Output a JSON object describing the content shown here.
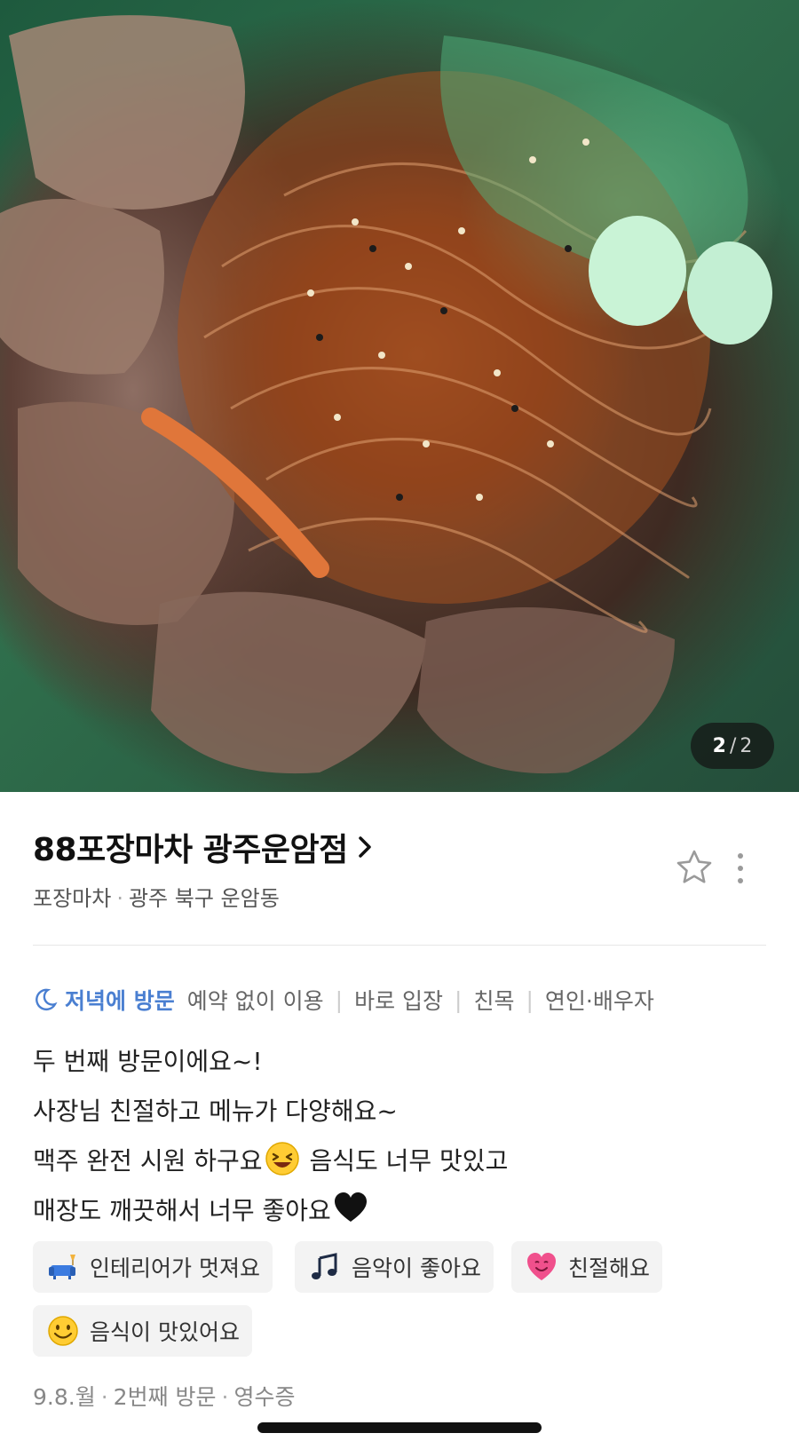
{
  "photo": {
    "counter_current": "2",
    "counter_separator": "/",
    "counter_total": "2"
  },
  "place": {
    "name": "88포장마차 광주운암점",
    "category": "포장마차",
    "separator": "·",
    "location": "광주 북구 운암동",
    "star_icon": "star-outline-icon",
    "more_icon": "vertical-ellipsis-icon"
  },
  "visit": {
    "icon": "moon-icon",
    "time": "저녁에 방문",
    "tags": [
      "예약 없이 이용",
      "바로 입장",
      "친목",
      "연인·배우자"
    ],
    "bar": "|"
  },
  "review": {
    "line1": "두 번째 방문이에요~!",
    "line2": "사장님 친절하고 메뉴가 다양해요~",
    "line3a": "맥주 완전 시원 하구요",
    "line3b": " 음식도 너무 맛있고",
    "line4": "매장도 깨끗해서 너무 좋아요",
    "emoji_laugh": "laughing-face-emoji",
    "emoji_heart": "black-heart-emoji"
  },
  "keywords": [
    {
      "label": "인테리어가 멋져요",
      "icon": "sofa-lamp-icon"
    },
    {
      "label": "음악이 좋아요",
      "icon": "music-note-icon"
    },
    {
      "label": "친절해요",
      "icon": "heart-face-icon"
    },
    {
      "label": "음식이 맛있어요",
      "icon": "yummy-face-icon"
    }
  ],
  "meta": {
    "date": "9.8.월",
    "visit_count": "2번째 방문",
    "proof": "영수증",
    "separator": "·"
  },
  "colors": {
    "accent_blue": "#4a7fd1",
    "chip_bg": "#f3f3f3",
    "divider": "#e6e6e6"
  }
}
